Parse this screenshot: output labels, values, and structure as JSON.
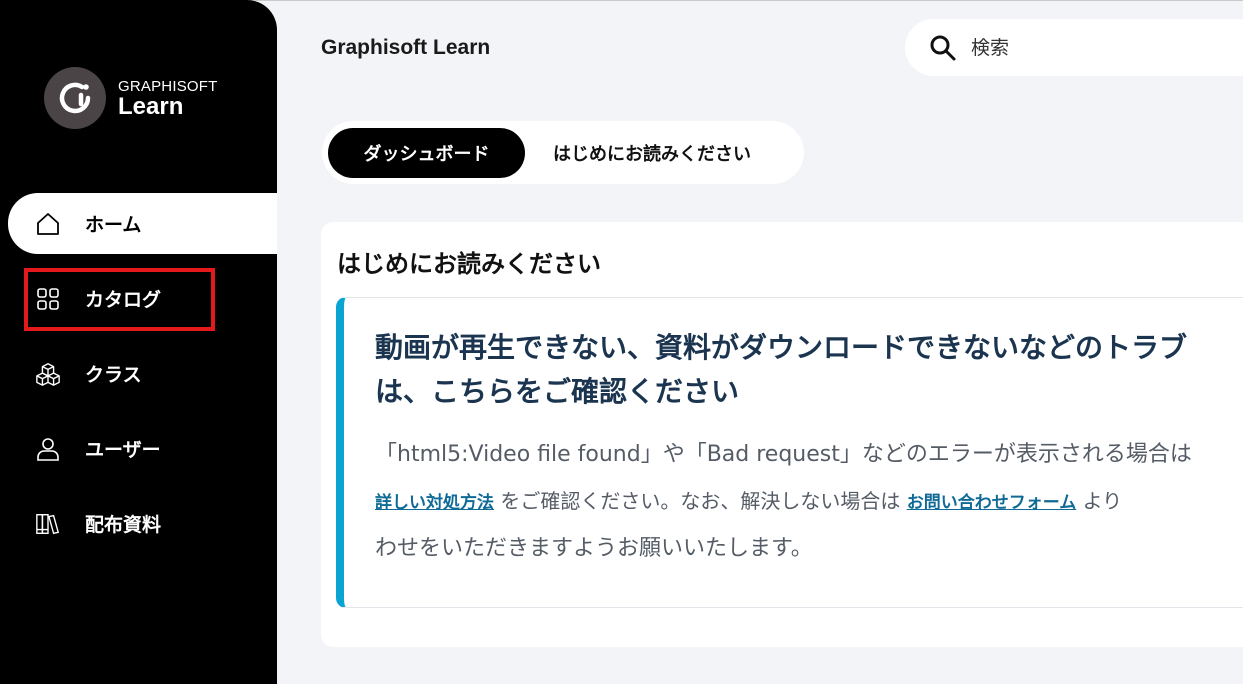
{
  "brand": {
    "top": "GRAPHISOFT",
    "bottom": "Learn"
  },
  "sidebar": {
    "items": [
      {
        "label": "ホーム",
        "icon": "home-icon"
      },
      {
        "label": "カタログ",
        "icon": "grid-icon"
      },
      {
        "label": "クラス",
        "icon": "cubes-icon"
      },
      {
        "label": "ユーザー",
        "icon": "user-icon"
      },
      {
        "label": "配布資料",
        "icon": "books-icon"
      }
    ]
  },
  "header": {
    "title": "Graphisoft Learn"
  },
  "search": {
    "placeholder": "検索"
  },
  "tabs": [
    {
      "label": "ダッシュボード"
    },
    {
      "label": "はじめにお読みください"
    }
  ],
  "card": {
    "heading": "はじめにお読みください",
    "notice": {
      "title_line1": "動画が再生できない、資料がダウンロードできないなどのトラブ",
      "title_line2": "は、こちらをご確認ください",
      "body_line1": "「html5:Video file found」や「Bad request」などのエラーが表示される場合は",
      "link1": "詳しい対処方法",
      "body_line2_mid": "をご確認ください。なお、解決しない場合は",
      "link2": "お問い合わせフォーム",
      "body_line2_end": "より",
      "body_line3": "わせをいただきますようお願いいたします。"
    }
  },
  "colors": {
    "accent": "#0aa4d2",
    "highlight": "#e3191b",
    "sidebar_bg": "#000000"
  }
}
